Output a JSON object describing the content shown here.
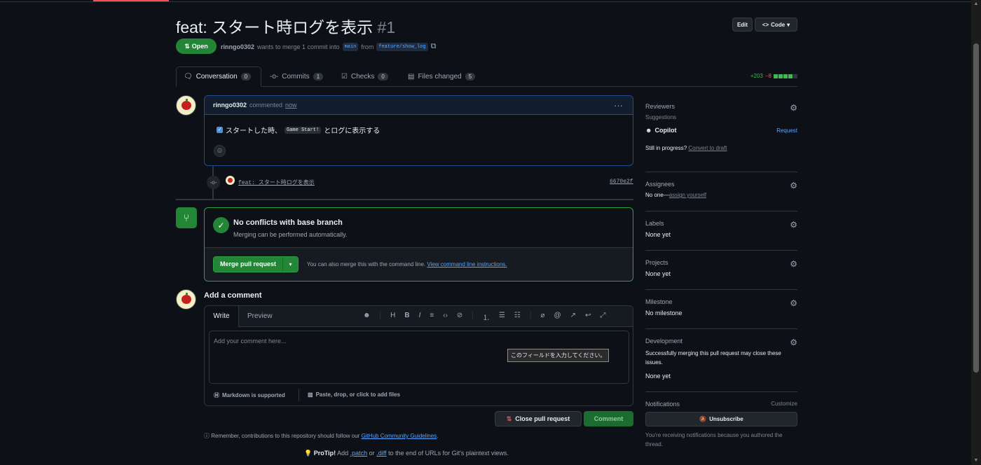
{
  "pr": {
    "title": "feat: スタート時ログを表示",
    "number": "#1",
    "state": "Open",
    "author": "rinngo0302",
    "merge_text": "wants to merge 1 commit into",
    "base_branch": "main",
    "from_text": "from",
    "head_branch": "feature/show_log",
    "edit_label": "Edit",
    "code_label": "Code"
  },
  "tabs": [
    {
      "label": "Conversation",
      "count": "0"
    },
    {
      "label": "Commits",
      "count": "1"
    },
    {
      "label": "Checks",
      "count": "0"
    },
    {
      "label": "Files changed",
      "count": "5"
    }
  ],
  "diffstat": {
    "additions": "+203",
    "deletions": "−8"
  },
  "comment": {
    "author": "rinngo0302",
    "action": "commented",
    "time": "now",
    "body_prefix": "スタートした時、",
    "body_code": "Game Start!",
    "body_suffix": "とログに表示する"
  },
  "commit": {
    "message": "feat: スタート時ログを表示",
    "sha": "6670e2f"
  },
  "merge": {
    "title": "No conflicts with base branch",
    "subtitle": "Merging can be performed automatically.",
    "button": "Merge pull request",
    "cli_text": "You can also merge this with the command line.",
    "cli_link": "View command line instructions."
  },
  "add_comment": {
    "heading": "Add a comment",
    "tab_write": "Write",
    "tab_preview": "Preview",
    "placeholder": "Add your comment here...",
    "tooltip": "このフィールドを入力してください。",
    "markdown": "Markdown is supported",
    "attach": "Paste, drop, or click to add files",
    "close_button": "Close pull request",
    "comment_button": "Comment"
  },
  "footer": {
    "remember_prefix": "Remember, contributions to this repository should follow our",
    "guidelines": "GitHub Community Guidelines",
    "protip_label": "ProTip!",
    "protip_add": "Add",
    "patch": ".patch",
    "or": "or",
    "diff": ".diff",
    "protip_end": "to the end of URLs for Git's plaintext views."
  },
  "sidebar": {
    "reviewers": {
      "title": "Reviewers",
      "suggestions": "Suggestions",
      "copilot": "Copilot",
      "request": "Request",
      "in_progress": "Still in progress?",
      "convert": "Convert to draft"
    },
    "assignees": {
      "title": "Assignees",
      "none": "No one—",
      "assign": "assign yourself"
    },
    "labels": {
      "title": "Labels",
      "value": "None yet"
    },
    "projects": {
      "title": "Projects",
      "value": "None yet"
    },
    "milestone": {
      "title": "Milestone",
      "value": "No milestone"
    },
    "development": {
      "title": "Development",
      "desc": "Successfully merging this pull request may close these issues.",
      "value": "None yet"
    },
    "notifications": {
      "title": "Notifications",
      "customize": "Customize",
      "button": "Unsubscribe",
      "desc": "You're receiving notifications because you authored the thread."
    }
  }
}
